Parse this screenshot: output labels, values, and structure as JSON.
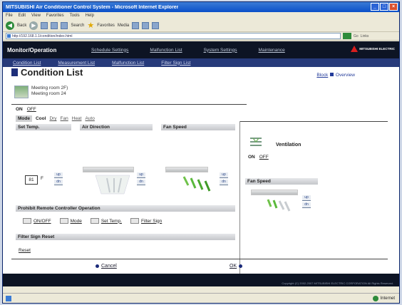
{
  "browser": {
    "title": "MITSUBISHI Air Conditioner Control System - Microsoft Internet Explorer",
    "menu": [
      "File",
      "Edit",
      "View",
      "Favorites",
      "Tools",
      "Help"
    ],
    "toolbar": {
      "back": "Back",
      "search": "Search",
      "favorites": "Favorites",
      "media": "Media"
    },
    "address": "http://192.168.1.1/condition/index.html",
    "go": "Go",
    "links": "Links"
  },
  "nav": {
    "main": "Monitor/Operation",
    "items": [
      "Schedule Settings",
      "Malfunction List",
      "System Settings",
      "Maintenance"
    ],
    "logo_text": "MITSUBISHI ELECTRIC"
  },
  "subnav": [
    "Condition List",
    "Measurement List",
    "Malfunction List",
    "Filter Sign List"
  ],
  "page": {
    "title": "Condition List",
    "block_link": "Block",
    "overview_link": "Overview",
    "group": [
      "Meeting room 2F)",
      "Meeting room 24"
    ]
  },
  "ac": {
    "on": "ON",
    "off": "OFF",
    "mode_label": "Mode",
    "mode_selected": "Cool",
    "mode_options": [
      "Dry",
      "Fan",
      "Heat",
      "Auto"
    ],
    "settemp_label": "Set Temp.",
    "airdir_label": "Air Direction",
    "fanspeed_label": "Fan Speed",
    "temp_value": "81",
    "temp_unit": "F",
    "up": "up",
    "dn": "dn"
  },
  "prohibit": {
    "header": "Prohibit Remote Controller Operation",
    "items": [
      "ON/OFF",
      "Mode",
      "Set Temp.",
      "Filter Sign"
    ]
  },
  "filter": {
    "header": "Filter Sign Reset",
    "reset": "Reset"
  },
  "ventilation": {
    "label": "Ventilation",
    "on": "ON",
    "off": "OFF",
    "fanspeed_label": "Fan Speed"
  },
  "actions": {
    "cancel": "Cancel",
    "ok": "OK"
  },
  "footer": {
    "copyright": "Copyright (C) 2002-2007 MITSUBISHI ELECTRIC CORPORATION All Rights Reserved."
  },
  "status": {
    "zone": "Internet"
  },
  "colors": {
    "nav_bg": "#0d1424",
    "subnav_bg": "#273a7a",
    "title_accent": "#1f2f7a",
    "logo_red": "#d81e1e"
  }
}
